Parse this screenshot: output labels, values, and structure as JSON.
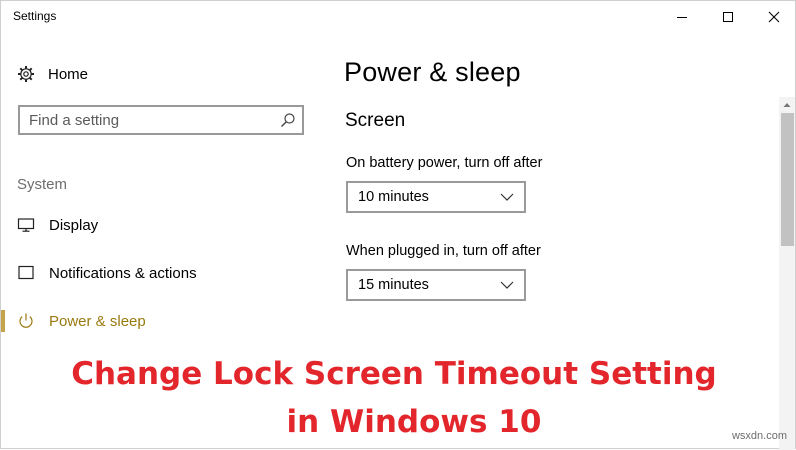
{
  "window": {
    "title": "Settings",
    "controls": {
      "minimize": "minimize-icon",
      "maximize": "maximize-icon",
      "close": "close-icon"
    }
  },
  "sidebar": {
    "home_label": "Home",
    "search": {
      "placeholder": "Find a setting"
    },
    "section_label": "System",
    "items": [
      {
        "label": "Display",
        "icon": "monitor-icon",
        "selected": false
      },
      {
        "label": "Notifications & actions",
        "icon": "message-icon",
        "selected": false
      },
      {
        "label": "Power & sleep",
        "icon": "power-icon",
        "selected": true
      }
    ]
  },
  "main": {
    "title": "Power & sleep",
    "section": "Screen",
    "battery": {
      "label": "On battery power, turn off after",
      "value": "10 minutes"
    },
    "plugged": {
      "label": "When plugged in, turn off after",
      "value": "15 minutes"
    }
  },
  "overlay": {
    "line1": "Change Lock Screen Timeout Setting",
    "line2": "in Windows 10",
    "color": "#e3262b"
  },
  "watermark": "wsxdn.com",
  "colors": {
    "accent": "#c4a44a",
    "selected_text": "#9a7a10",
    "muted": "#6d6d6d"
  }
}
